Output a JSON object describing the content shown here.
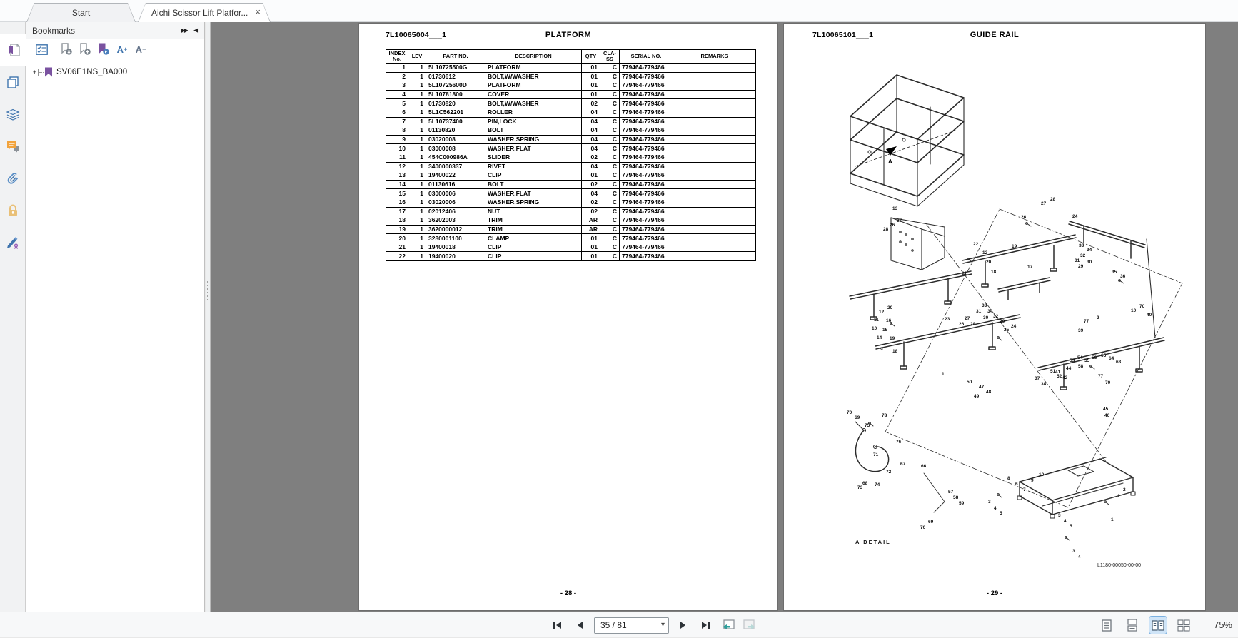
{
  "window": {
    "tab_start": "Start",
    "tab_document": "Aichi Scissor Lift Platfor...",
    "close_glyph": "×"
  },
  "sidebar": {
    "header": {
      "title": "Bookmarks",
      "collapse_all_glyph": "▶▶",
      "collapse_panel_glyph": "◀"
    },
    "toolbar": {
      "font_up_letter": "A",
      "font_up_sign": "+",
      "font_down_letter": "A",
      "font_down_sign": "−"
    },
    "tree": {
      "expand_glyph": "+",
      "root_label": "SV06E1NS_BA000"
    }
  },
  "pages": {
    "left": {
      "doc_no": "7L10065004___1",
      "title": "PLATFORM",
      "page_label": "- 28 -",
      "table": {
        "headers": [
          "INDEX\nNo.",
          "LEV",
          "PART NO.",
          "DESCRIPTION",
          "QTY",
          "CLA-\nSS",
          "SERIAL NO.",
          "REMARKS"
        ],
        "rows": [
          [
            "1",
            "1",
            "5L10725500G",
            "PLATFORM",
            "01",
            "C",
            "779464-779466",
            ""
          ],
          [
            "2",
            "1",
            "01730612",
            "BOLT,W/WASHER",
            "01",
            "C",
            "779464-779466",
            ""
          ],
          [
            "3",
            "1",
            "5L10725600D",
            "PLATFORM",
            "01",
            "C",
            "779464-779466",
            ""
          ],
          [
            "4",
            "1",
            "5L10781800",
            "COVER",
            "01",
            "C",
            "779464-779466",
            ""
          ],
          [
            "5",
            "1",
            "01730820",
            "BOLT,W/WASHER",
            "02",
            "C",
            "779464-779466",
            ""
          ],
          [
            "6",
            "1",
            "5L1C562201",
            "ROLLER",
            "04",
            "C",
            "779464-779466",
            ""
          ],
          [
            "7",
            "1",
            "5L10737400",
            "PIN,LOCK",
            "04",
            "C",
            "779464-779466",
            ""
          ],
          [
            "8",
            "1",
            "01130820",
            "BOLT",
            "04",
            "C",
            "779464-779466",
            ""
          ],
          [
            "9",
            "1",
            "03020008",
            "WASHER,SPRING",
            "04",
            "C",
            "779464-779466",
            ""
          ],
          [
            "10",
            "1",
            "03000008",
            "WASHER,FLAT",
            "04",
            "C",
            "779464-779466",
            ""
          ],
          [
            "11",
            "1",
            "454C000986A",
            "SLIDER",
            "02",
            "C",
            "779464-779466",
            ""
          ],
          [
            "12",
            "1",
            "3400000337",
            "RIVET",
            "04",
            "C",
            "779464-779466",
            ""
          ],
          [
            "13",
            "1",
            "19400022",
            "CLIP",
            "01",
            "C",
            "779464-779466",
            ""
          ],
          [
            "14",
            "1",
            "01130616",
            "BOLT",
            "02",
            "C",
            "779464-779466",
            ""
          ],
          [
            "15",
            "1",
            "03000006",
            "WASHER,FLAT",
            "04",
            "C",
            "779464-779466",
            ""
          ],
          [
            "16",
            "1",
            "03020006",
            "WASHER,SPRING",
            "02",
            "C",
            "779464-779466",
            ""
          ],
          [
            "17",
            "1",
            "02012406",
            "NUT",
            "02",
            "C",
            "779464-779466",
            ""
          ],
          [
            "18",
            "1",
            "36202003",
            "TRIM",
            "AR",
            "C",
            "779464-779466",
            ""
          ],
          [
            "19",
            "1",
            "3620000012",
            "TRIM",
            "AR",
            "C",
            "779464-779466",
            ""
          ],
          [
            "20",
            "1",
            "3280001100",
            "CLAMP",
            "01",
            "C",
            "779464-779466",
            ""
          ],
          [
            "21",
            "1",
            "19400018",
            "CLIP",
            "01",
            "C",
            "779464-779466",
            ""
          ],
          [
            "22",
            "1",
            "19400020",
            "CLIP",
            "01",
            "C",
            "779464-779466",
            ""
          ]
        ]
      }
    },
    "right": {
      "doc_no": "7L10065101___1",
      "title": "GUIDE RAIL",
      "page_label": "- 29 -",
      "arrow_label": "A",
      "detail_label": "A  DETAIL",
      "drawing_no": "L1180-00050-00-00",
      "callouts": [
        [
          13,
          152,
          231
        ],
        [
          27,
          360,
          224
        ],
        [
          28,
          373,
          218
        ],
        [
          26,
          332,
          243
        ],
        [
          24,
          404,
          242
        ],
        [
          35,
          459,
          320
        ],
        [
          36,
          471,
          326
        ],
        [
          33,
          413,
          283
        ],
        [
          34,
          424,
          289
        ],
        [
          32,
          415,
          297
        ],
        [
          31,
          407,
          304
        ],
        [
          30,
          424,
          306
        ],
        [
          29,
          412,
          312
        ],
        [
          22,
          265,
          281
        ],
        [
          19,
          319,
          284
        ],
        [
          12,
          278,
          293
        ],
        [
          20,
          283,
          306
        ],
        [
          17,
          341,
          313
        ],
        [
          18,
          290,
          320
        ],
        [
          21,
          249,
          322
        ],
        [
          23,
          225,
          386
        ],
        [
          26,
          148,
          254
        ],
        [
          27,
          158,
          248
        ],
        [
          28,
          139,
          260
        ],
        [
          12,
          133,
          376
        ],
        [
          20,
          145,
          370
        ],
        [
          11,
          126,
          387
        ],
        [
          16,
          143,
          388
        ],
        [
          10,
          123,
          399
        ],
        [
          15,
          138,
          401
        ],
        [
          14,
          130,
          412
        ],
        [
          19,
          148,
          413
        ],
        [
          9,
          135,
          428
        ],
        [
          18,
          152,
          431
        ],
        [
          33,
          277,
          367
        ],
        [
          31,
          269,
          375
        ],
        [
          34,
          285,
          375
        ],
        [
          30,
          279,
          384
        ],
        [
          32,
          293,
          382
        ],
        [
          29,
          302,
          389
        ],
        [
          28,
          261,
          393
        ],
        [
          27,
          253,
          385
        ],
        [
          26,
          245,
          393
        ],
        [
          25,
          308,
          401
        ],
        [
          24,
          318,
          396
        ],
        [
          10,
          486,
          374
        ],
        [
          70,
          498,
          368
        ],
        [
          40,
          508,
          380
        ],
        [
          77,
          440,
          466
        ],
        [
          70,
          450,
          475
        ],
        [
          2,
          438,
          384
        ],
        [
          77,
          420,
          389
        ],
        [
          53,
          400,
          444
        ],
        [
          54,
          411,
          440
        ],
        [
          55,
          421,
          444
        ],
        [
          56,
          431,
          440
        ],
        [
          58,
          412,
          452
        ],
        [
          64,
          455,
          441
        ],
        [
          63,
          465,
          446
        ],
        [
          65,
          444,
          437
        ],
        [
          44,
          395,
          455
        ],
        [
          41,
          380,
          460
        ],
        [
          42,
          390,
          468
        ],
        [
          39,
          412,
          402
        ],
        [
          51,
          373,
          459
        ],
        [
          52,
          382,
          466
        ],
        [
          45,
          447,
          512
        ],
        [
          46,
          449,
          521
        ],
        [
          38,
          360,
          477
        ],
        [
          37,
          351,
          469
        ],
        [
          47,
          273,
          481
        ],
        [
          48,
          283,
          488
        ],
        [
          49,
          266,
          494
        ],
        [
          50,
          256,
          474
        ],
        [
          1,
          221,
          463
        ],
        [
          70,
          88,
          517
        ],
        [
          69,
          99,
          524
        ],
        [
          78,
          137,
          521
        ],
        [
          75,
          113,
          535
        ],
        [
          76,
          157,
          558
        ],
        [
          71,
          125,
          576
        ],
        [
          68,
          110,
          616
        ],
        [
          73,
          103,
          622
        ],
        [
          74,
          127,
          618
        ],
        [
          72,
          143,
          600
        ],
        [
          67,
          163,
          589
        ],
        [
          66,
          192,
          592
        ],
        [
          57,
          230,
          628
        ],
        [
          58,
          237,
          636
        ],
        [
          59,
          245,
          644
        ],
        [
          70,
          191,
          678
        ],
        [
          69,
          202,
          670
        ],
        [
          8,
          313,
          609
        ],
        [
          6,
          324,
          617
        ],
        [
          7,
          335,
          625
        ],
        [
          9,
          346,
          612
        ],
        [
          10,
          357,
          604
        ],
        [
          3,
          286,
          642
        ],
        [
          4,
          294,
          651
        ],
        [
          5,
          302,
          658
        ],
        [
          1,
          467,
          634
        ],
        [
          2,
          475,
          625
        ],
        [
          3,
          384,
          661
        ],
        [
          4,
          392,
          669
        ],
        [
          5,
          400,
          676
        ],
        [
          3,
          404,
          711
        ],
        [
          4,
          412,
          719
        ],
        [
          1,
          458,
          667
        ]
      ]
    }
  },
  "statusbar": {
    "page_indicator": "35 / 81",
    "dropdown_caret": "▾",
    "zoom_level": "75%"
  },
  "colors": {
    "doc_background": "#7f7f7f",
    "icon_blue": "#3f74ad",
    "bookmark_purple": "#7a52a0",
    "comment_orange": "#f2a33c",
    "lock_tan": "#e9c077",
    "active_view_bg": "#cfe4f7"
  }
}
